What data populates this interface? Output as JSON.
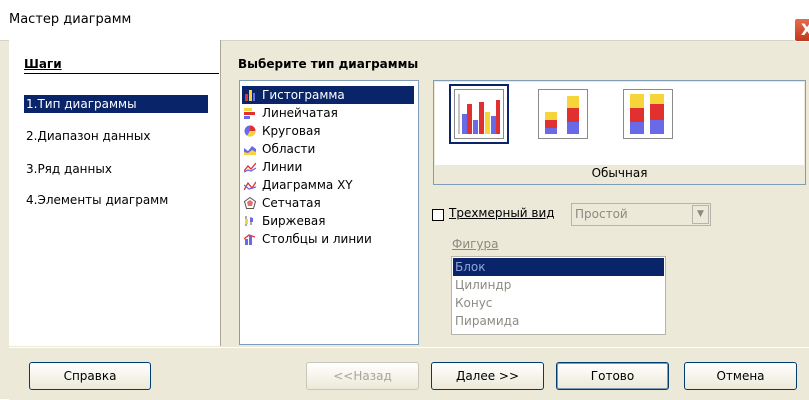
{
  "window": {
    "title": "Мастер диаграмм",
    "close_symbol": "X"
  },
  "steps": {
    "title": "Шаги",
    "items": [
      {
        "label": "1.Тип диаграммы",
        "active": true
      },
      {
        "label": "2.Диапазон данных",
        "active": false
      },
      {
        "label": "3.Ряд данных",
        "active": false
      },
      {
        "label": "4.Элементы диаграмм",
        "active": false
      }
    ]
  },
  "main": {
    "heading": "Выберите тип диаграммы",
    "chart_types": [
      {
        "label": "Гистограмма",
        "icon": "column-chart-icon",
        "selected": true
      },
      {
        "label": "Линейчатая",
        "icon": "bar-chart-icon",
        "selected": false
      },
      {
        "label": "Круговая",
        "icon": "pie-chart-icon",
        "selected": false
      },
      {
        "label": "Области",
        "icon": "area-chart-icon",
        "selected": false
      },
      {
        "label": "Линии",
        "icon": "line-chart-icon",
        "selected": false
      },
      {
        "label": "Диаграмма XY",
        "icon": "xy-chart-icon",
        "selected": false
      },
      {
        "label": "Сетчатая",
        "icon": "net-chart-icon",
        "selected": false
      },
      {
        "label": "Биржевая",
        "icon": "stock-chart-icon",
        "selected": false
      },
      {
        "label": "Столбцы и линии",
        "icon": "column-line-chart-icon",
        "selected": false
      }
    ],
    "variant_caption": "Обычная",
    "variants": [
      "normal-variant-icon",
      "stacked-variant-icon",
      "percent-stacked-variant-icon"
    ],
    "three_d": {
      "label": "Трехмерный вид",
      "checked": false,
      "combo_value": "Простой"
    },
    "shape": {
      "label": "Фигура",
      "options": [
        "Блок",
        "Цилиндр",
        "Конус",
        "Пирамида"
      ],
      "selected": "Блок"
    }
  },
  "buttons": {
    "help": "Справка",
    "back": "<<Назад",
    "next": "Далее >>",
    "finish": "Готово",
    "cancel": "Отмена"
  },
  "colors": {
    "selection": "#0a246a",
    "bar_red": "#e03030",
    "bar_yellow": "#f5d53a",
    "bar_blue": "#6a6ae8"
  }
}
